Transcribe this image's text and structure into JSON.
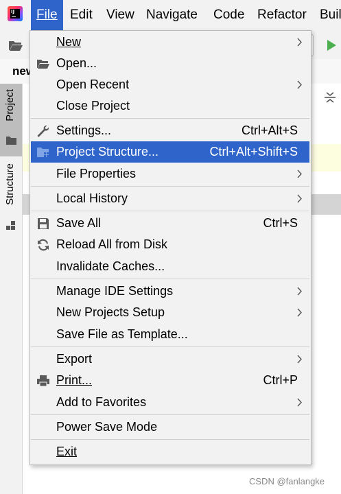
{
  "menubar": {
    "logo_text": "IJ",
    "items": [
      "File",
      "Edit",
      "View",
      "Navigate",
      "Code",
      "Refactor",
      "Buil"
    ]
  },
  "tab": {
    "label": "new"
  },
  "side_tabs": {
    "project": "Project",
    "structure": "Structure"
  },
  "file_menu": {
    "new": "New",
    "open": "Open...",
    "open_recent": "Open Recent",
    "close_project": "Close Project",
    "settings": "Settings...",
    "settings_shortcut": "Ctrl+Alt+S",
    "project_structure": "Project Structure...",
    "project_structure_shortcut": "Ctrl+Alt+Shift+S",
    "file_properties": "File Properties",
    "local_history": "Local History",
    "save_all": "Save All",
    "save_all_shortcut": "Ctrl+S",
    "reload_all": "Reload All from Disk",
    "invalidate_caches": "Invalidate Caches...",
    "manage_ide_settings": "Manage IDE Settings",
    "new_projects_setup": "New Projects Setup",
    "save_file_as_template": "Save File as Template...",
    "export": "Export",
    "print": "Print...",
    "print_shortcut": "Ctrl+P",
    "add_to_favorites": "Add to Favorites",
    "power_save_mode": "Power Save Mode",
    "exit": "Exit"
  },
  "watermark": "CSDN @fanlangke",
  "colors": {
    "highlight": "#2f65ca",
    "menu_bg": "#f2f2f2",
    "run_green": "#4caf50"
  }
}
